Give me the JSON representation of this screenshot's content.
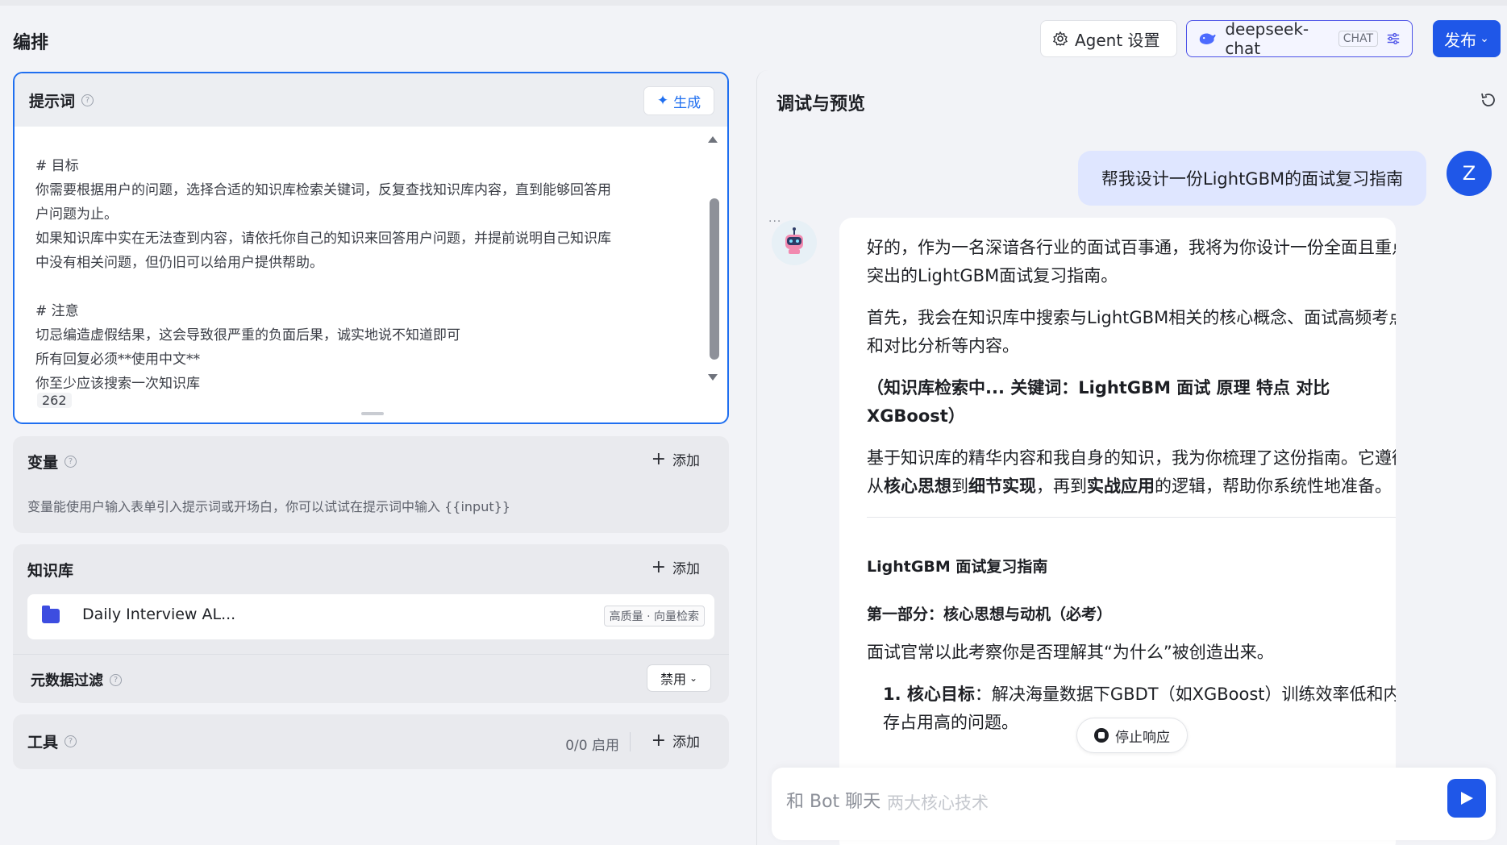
{
  "header": {
    "title": "编排",
    "agent_settings": "Agent 设置",
    "model_name": "deepseek-chat",
    "model_badge": "CHAT",
    "publish": "发布"
  },
  "prompt": {
    "title": "提示词",
    "generate": "生成",
    "text": "# 目标\n你需要根据用户的问题，选择合适的知识库检索关键词，反复查找知识库内容，直到能够回答用\n户问题为止。\n如果知识库中实在无法查到内容，请依托你自己的知识来回答用户问题，并提前说明自己知识库\n中没有相关问题，但仍旧可以给用户提供帮助。\n\n# 注意\n切忌编造虚假结果，这会导致很严重的负面后果，诚实地说不知道即可\n所有回复必须**使用中文**\n你至少应该搜索一次知识库",
    "char_count": "262"
  },
  "variables": {
    "title": "变量",
    "add": "添加",
    "description": "变量能使用户输入表单引入提示词或开场白，你可以试试在提示词中输入 {{input}}"
  },
  "knowledge": {
    "title": "知识库",
    "add": "添加",
    "item_name": "Daily Interview AL...",
    "item_tag": "高质量 · 向量检索",
    "metadata_filter": "元数据过滤",
    "filter_value": "禁用"
  },
  "tools": {
    "title": "工具",
    "count": "0/0 启用",
    "add": "添加"
  },
  "preview": {
    "title": "调试与预览",
    "user_message": "帮我设计一份LightGBM的面试复习指南",
    "user_avatar": "Z",
    "bot_p1": "好的，作为一名深谙各行业的面试百事通，我将为你设计一份全面且重点突出的LightGBM面试复习指南。",
    "bot_p2": "首先，我会在知识库中搜索与LightGBM相关的核心概念、面试高频考点和对比分析等内容。",
    "bot_p3": "（知识库检索中... 关键词：LightGBM 面试 原理 特点 对比 XGBoost）",
    "bot_p4a": "基于知识库的精华内容和我自身的知识，我为你梳理了这份指南。它遵循从",
    "bot_p4b": "核心思想",
    "bot_p4c": "到",
    "bot_p4d": "细节实现",
    "bot_p4e": "，再到",
    "bot_p4f": "实战应用",
    "bot_p4g": "的逻辑，帮助你系统性地准备。",
    "guide_title": "LightGBM 面试复习指南",
    "part1_title": "第一部分：核心思想与动机（必考）",
    "part1_desc": "面试官常以此考察你是否理解其“为什么”被创造出来。",
    "item1_label": "1. 核心目标",
    "item1_text": "：解决海量数据下GBDT（如XGBoost）训练效率低和内存占用高的问题。",
    "stop": "停止响应",
    "input_placeholder": "和 Bot 聊天",
    "faded_text": "两大核心技术"
  },
  "colors": {
    "accent": "#1f57e8",
    "prompt_border": "#1f6ff0",
    "user_bubble": "#dfe6ff"
  }
}
